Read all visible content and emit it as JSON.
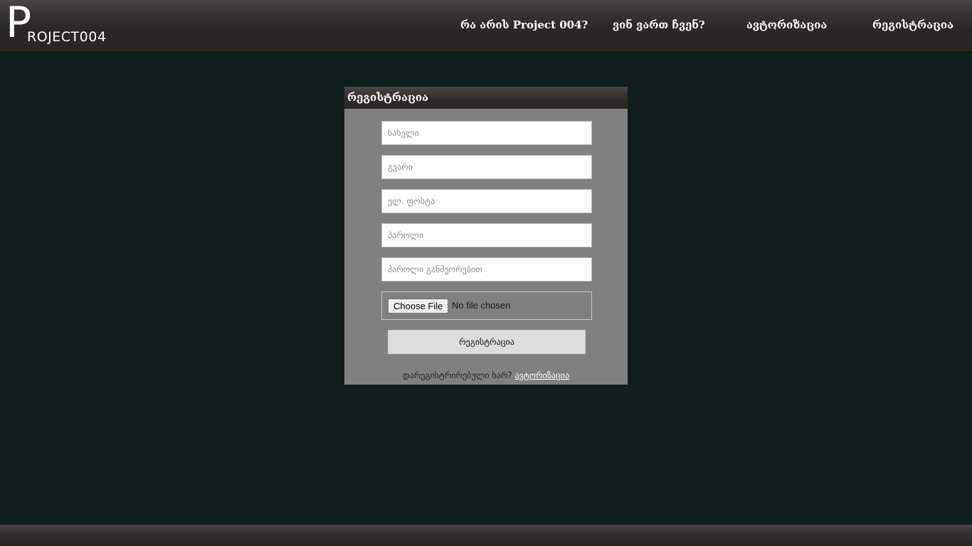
{
  "logo": {
    "first_letter": "P",
    "rest": "ROJECT004"
  },
  "nav": {
    "items": [
      {
        "label": "რა არის Project 004?"
      },
      {
        "label": "ვინ ვართ ჩვენ?"
      },
      {
        "label": "ავტორიზაცია"
      },
      {
        "label": "რეგისტრაცია"
      }
    ]
  },
  "form": {
    "title": "რეგისტრაცია",
    "fields": {
      "first_name": {
        "placeholder": "სახელი",
        "value": ""
      },
      "last_name": {
        "placeholder": "გვარი",
        "value": ""
      },
      "email": {
        "placeholder": "ელ. ფოსტა",
        "value": ""
      },
      "password": {
        "placeholder": "პაროლი",
        "value": ""
      },
      "password_repeat": {
        "placeholder": "პაროლი განმეორებით",
        "value": ""
      }
    },
    "file": {
      "button_label": "Choose File",
      "status": "No file chosen"
    },
    "submit_label": "რეგისტრაცია",
    "footer_text": "დარეგისტრირებული ხარ?",
    "footer_link": "ავტორიზაცია"
  }
}
